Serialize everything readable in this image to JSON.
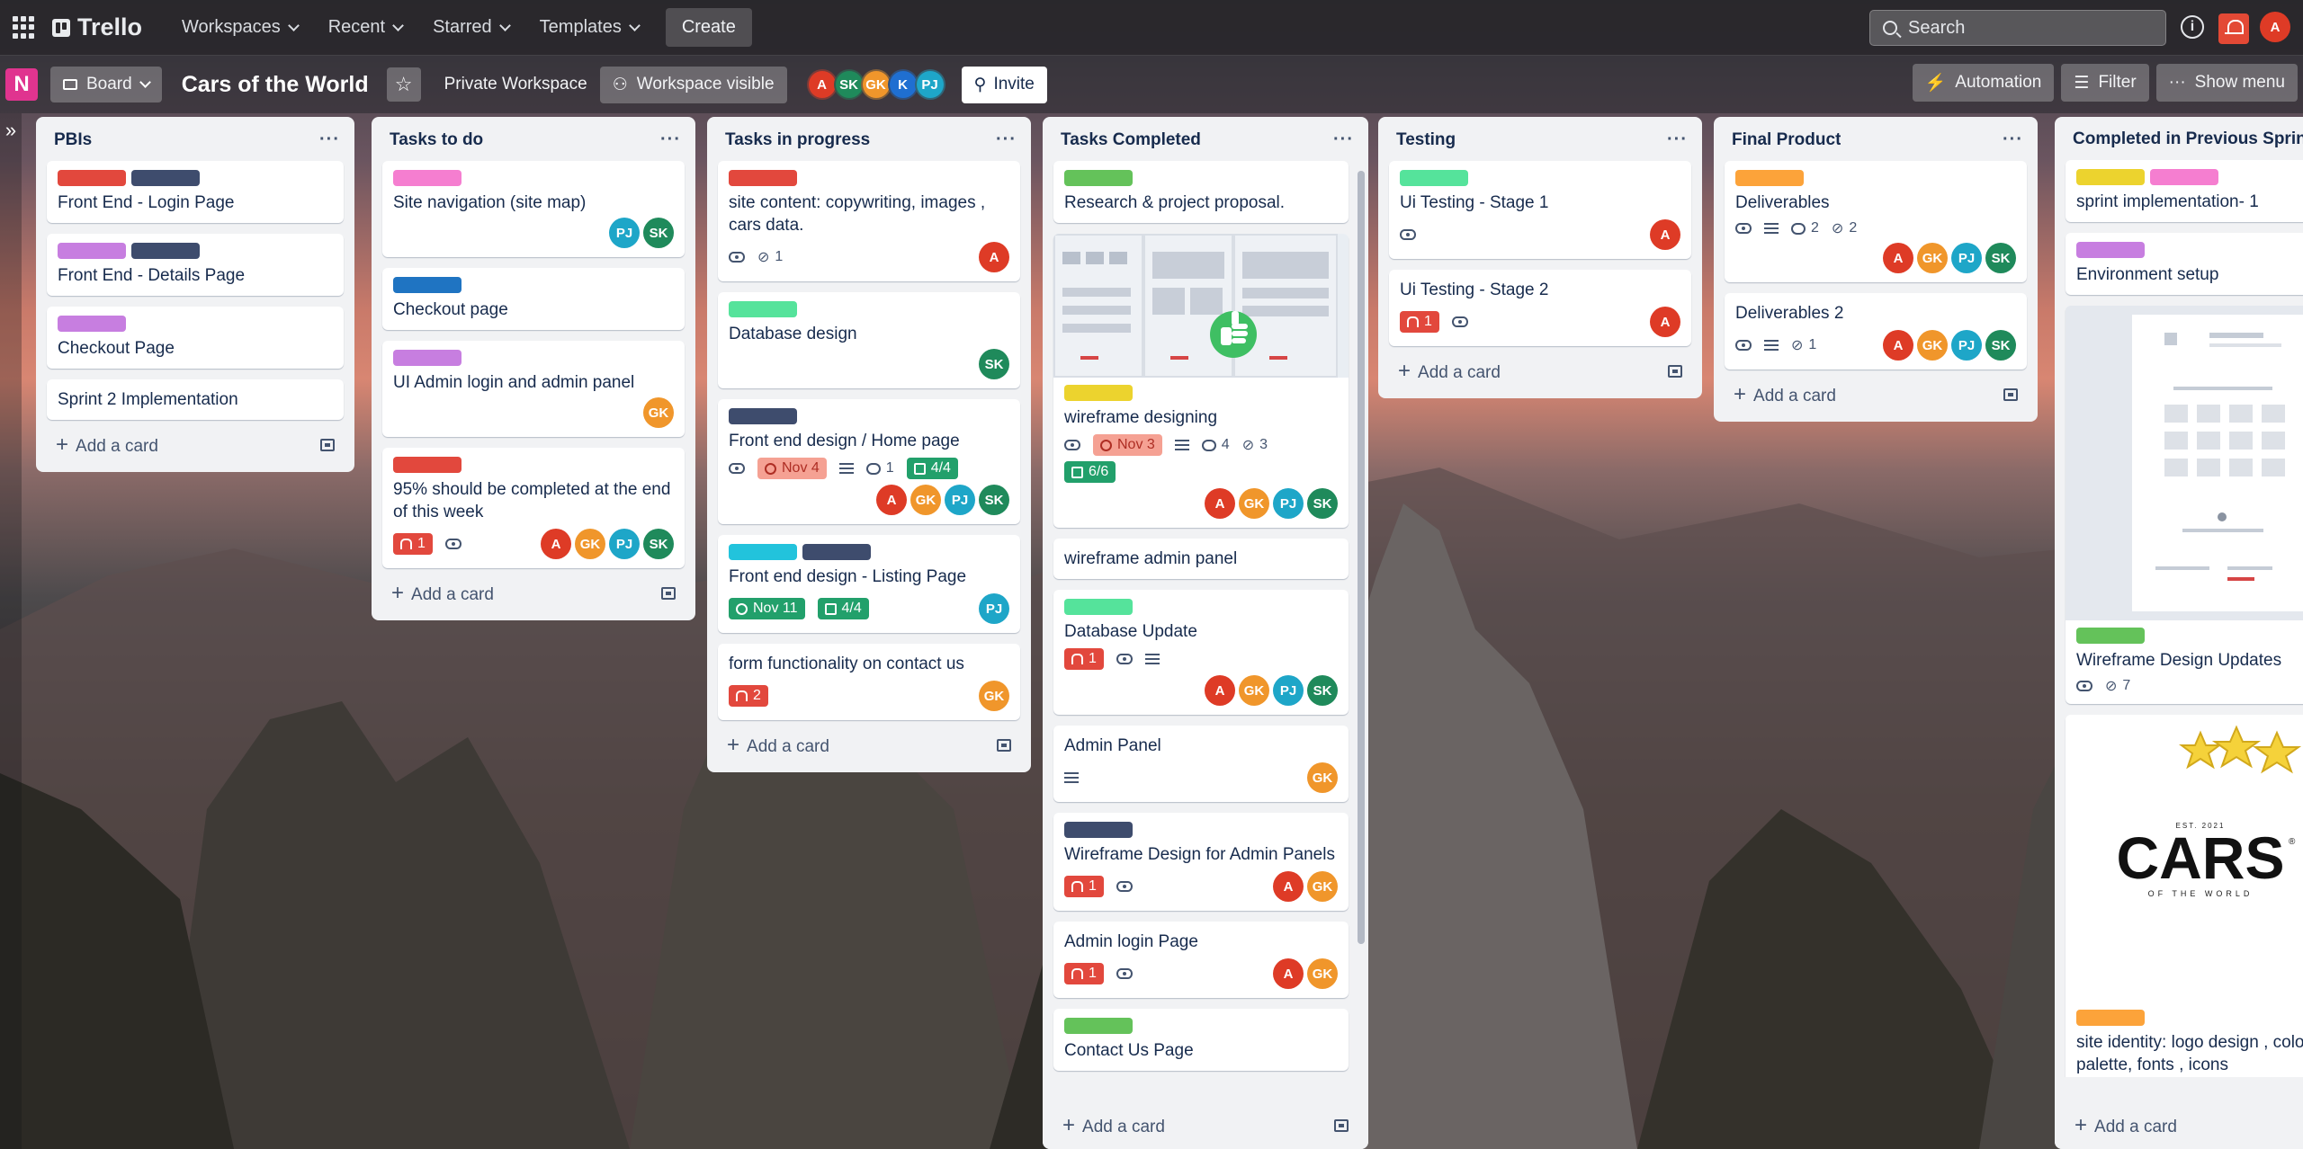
{
  "app": {
    "name": "Trello"
  },
  "topnav": {
    "items": [
      "Workspaces",
      "Recent",
      "Starred",
      "Templates"
    ],
    "create_label": "Create",
    "search_placeholder": "Search",
    "me_initial": "A"
  },
  "board": {
    "badge": "N",
    "view_label": "Board",
    "title": "Cars of the World",
    "workspace": "Private Workspace",
    "visibility": "Workspace visible",
    "members": [
      "A",
      "SK",
      "GK",
      "K",
      "PJ"
    ],
    "invite_label": "Invite",
    "automation_label": "Automation",
    "filter_label": "Filter",
    "show_menu_label": "Show menu"
  },
  "colors": {
    "red": "#e2483d",
    "navy": "#3e4c6d",
    "purple": "#c77ee0",
    "pink": "#f57ed0",
    "blue": "#1f74c2",
    "green": "#64c25a",
    "teal": "#55e39b",
    "cyan": "#22c3dc",
    "orange": "#fca33a",
    "yellow": "#ecd32e",
    "av_A": "#de3b26",
    "av_SK": "#1f8a5b",
    "av_GK": "#f0962b",
    "av_PJ": "#1ea6c8",
    "av_K": "#1f6fd1"
  },
  "lists": [
    {
      "title": "PBIs",
      "cards": [
        {
          "title": "Front End - Login Page"
        },
        {
          "title": "Front End - Details Page"
        },
        {
          "title": "Checkout Page"
        },
        {
          "title": "Sprint 2 Implementation"
        }
      ],
      "add_label": "Add a card"
    },
    {
      "title": "Tasks to do",
      "cards": [
        {
          "title": "Site navigation (site map)"
        },
        {
          "title": "Checkout page"
        },
        {
          "title": "UI Admin login and admin panel"
        },
        {
          "title": "95% should be completed at the end of this week",
          "badge": "1"
        }
      ],
      "add_label": "Add a card"
    },
    {
      "title": "Tasks in progress",
      "cards": [
        {
          "title": "site content: copywriting, images , cars data.",
          "attachments": "1"
        },
        {
          "title": "Database design"
        },
        {
          "title": "Front end design / Home page",
          "due": "Nov 4",
          "comments": "1",
          "checklist": "4/4"
        },
        {
          "title": "Front end design - Listing Page",
          "due": "Nov 11",
          "checklist": "4/4"
        },
        {
          "title": "form functionality on contact us",
          "badge": "2"
        }
      ],
      "add_label": "Add a card"
    },
    {
      "title": "Tasks Completed",
      "cards": [
        {
          "title": "Research & project proposal."
        },
        {
          "title": "wireframe designing",
          "due": "Nov 3",
          "comments": "4",
          "attachments": "3",
          "checklist": "6/6"
        },
        {
          "title": "wireframe admin panel"
        },
        {
          "title": "Database Update",
          "badge": "1"
        },
        {
          "title": "Admin Panel"
        },
        {
          "title": "Wireframe Design for Admin Panels",
          "badge": "1"
        },
        {
          "title": "Admin login Page",
          "badge": "1"
        },
        {
          "title": "Contact Us Page"
        }
      ],
      "add_label": "Add a card"
    },
    {
      "title": "Testing",
      "cards": [
        {
          "title": "Ui Testing - Stage 1"
        },
        {
          "title": "Ui Testing - Stage 2",
          "badge": "1"
        }
      ],
      "add_label": "Add a card"
    },
    {
      "title": "Final Product",
      "cards": [
        {
          "title": "Deliverables",
          "comments": "2",
          "attachments": "2"
        },
        {
          "title": "Deliverables 2",
          "attachments": "1"
        }
      ],
      "add_label": "Add a card"
    },
    {
      "title": "Completed in Previous Sprint",
      "cards": [
        {
          "title": "sprint implementation- 1"
        },
        {
          "title": "Environment setup"
        },
        {
          "title": "Wireframe Design Updates",
          "attachments": "7"
        },
        {
          "title": "site identity: logo design , color palette, fonts , icons"
        }
      ],
      "add_label": "Add a card"
    }
  ],
  "logo_art": {
    "est": "EST. 2021",
    "brand": "CARS",
    "registered": "®",
    "tagline": "OF THE WORLD"
  }
}
